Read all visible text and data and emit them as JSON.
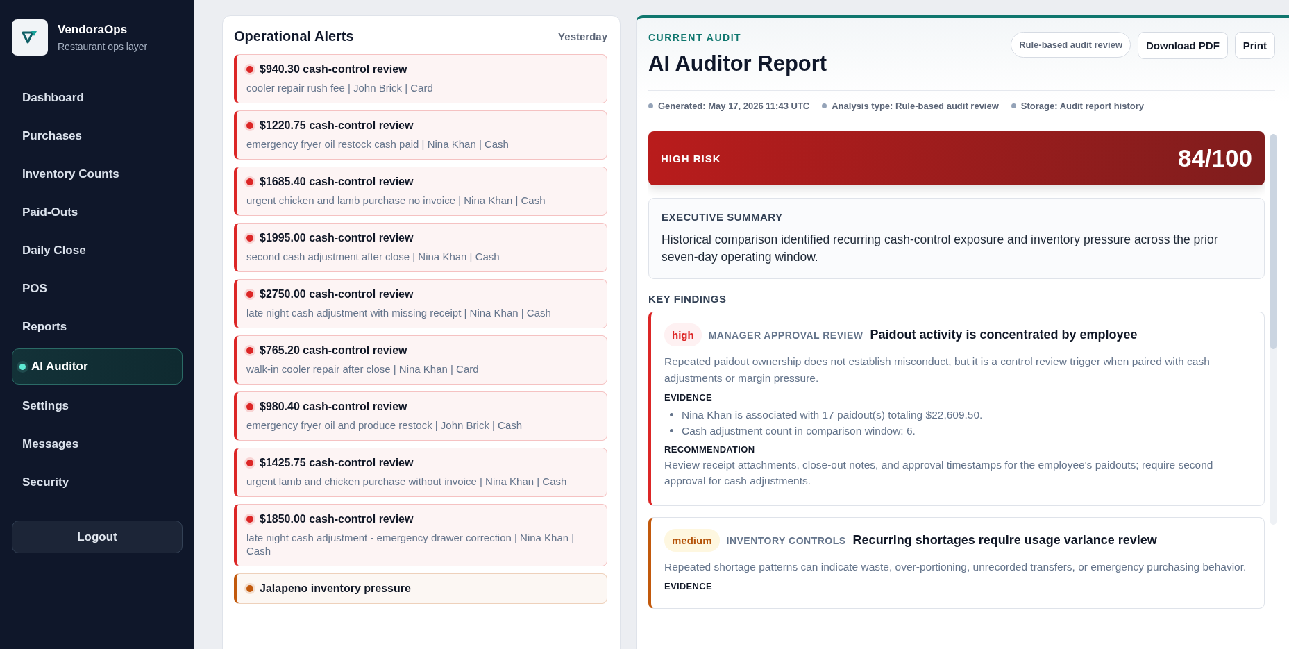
{
  "brand": {
    "name": "VendoraOps",
    "tagline": "Restaurant ops layer"
  },
  "sidebar": {
    "items": [
      {
        "label": "Dashboard",
        "selected": false
      },
      {
        "label": "Purchases",
        "selected": false
      },
      {
        "label": "Inventory Counts",
        "selected": false
      },
      {
        "label": "Paid-Outs",
        "selected": false
      },
      {
        "label": "Daily Close",
        "selected": false
      },
      {
        "label": "POS",
        "selected": false
      },
      {
        "label": "Reports",
        "selected": false
      },
      {
        "label": "AI Auditor",
        "selected": true
      },
      {
        "label": "Settings",
        "selected": false
      },
      {
        "label": "Messages",
        "selected": false
      },
      {
        "label": "Security",
        "selected": false
      }
    ],
    "logout": "Logout"
  },
  "alerts": {
    "title": "Operational Alerts",
    "period": "Yesterday",
    "items": [
      {
        "color": "#dc2626",
        "title": "$940.30 cash-control review",
        "detail": "cooler repair rush fee | John Brick | Card"
      },
      {
        "color": "#dc2626",
        "title": "$1220.75 cash-control review",
        "detail": "emergency fryer oil restock cash paid | Nina Khan | Cash"
      },
      {
        "color": "#dc2626",
        "title": "$1685.40 cash-control review",
        "detail": "urgent chicken and lamb purchase no invoice | Nina Khan | Cash"
      },
      {
        "color": "#dc2626",
        "title": "$1995.00 cash-control review",
        "detail": "second cash adjustment after close | Nina Khan | Cash"
      },
      {
        "color": "#dc2626",
        "title": "$2750.00 cash-control review",
        "detail": "late night cash adjustment with missing receipt | Nina Khan | Cash"
      },
      {
        "color": "#dc2626",
        "title": "$765.20 cash-control review",
        "detail": "walk-in cooler repair after close | Nina Khan | Card"
      },
      {
        "color": "#dc2626",
        "title": "$980.40 cash-control review",
        "detail": "emergency fryer oil and produce restock | John Brick | Cash"
      },
      {
        "color": "#dc2626",
        "title": "$1425.75 cash-control review",
        "detail": "urgent lamb and chicken purchase without invoice | Nina Khan | Cash"
      },
      {
        "color": "#dc2626",
        "title": "$1850.00 cash-control review",
        "detail": "late night cash adjustment - emergency drawer correction | Nina Khan | Cash"
      },
      {
        "color": "#c2590c",
        "title": "Jalapeno inventory pressure"
      }
    ]
  },
  "report": {
    "eyebrow": "CURRENT AUDIT",
    "title": "AI Auditor Report",
    "mode_badge": "Rule-based audit review",
    "buttons": [
      "Download PDF",
      "Print"
    ],
    "meta": [
      "Generated: May 17, 2026 11:43 UTC",
      "Analysis type: Rule-based audit review",
      "Storage: Audit report history"
    ],
    "risk": {
      "kind": "high",
      "label": "HIGH RISK",
      "score": "84/100"
    },
    "summary": {
      "heading": "EXECUTIVE SUMMARY",
      "text": "Historical comparison identified recurring cash-control exposure and inventory pressure across the prior seven-day operating window."
    },
    "findings_heading": "KEY FINDINGS",
    "findings": [
      {
        "severity": "high",
        "category": "MANAGER APPROVAL REVIEW",
        "title": "Paidout activity is concentrated by employee",
        "description": "Repeated paidout ownership does not establish misconduct, but it is a control review trigger when paired with cash adjustments or margin pressure.",
        "evidence_heading": "EVIDENCE",
        "evidence": [
          "Nina Khan is associated with 17 paidout(s) totaling $22,609.50.",
          "Cash adjustment count in comparison window: 6."
        ],
        "recommendation_heading": "RECOMMENDATION",
        "recommendation": "Review receipt attachments, close-out notes, and approval timestamps for the employee's paidouts; require second approval for cash adjustments."
      },
      {
        "severity": "medium",
        "category": "INVENTORY CONTROLS",
        "title": "Recurring shortages require usage variance review",
        "description": "Repeated shortage patterns can indicate waste, over-portioning, unrecorded transfers, or emergency purchasing behavior.",
        "evidence_heading": "EVIDENCE"
      }
    ]
  }
}
